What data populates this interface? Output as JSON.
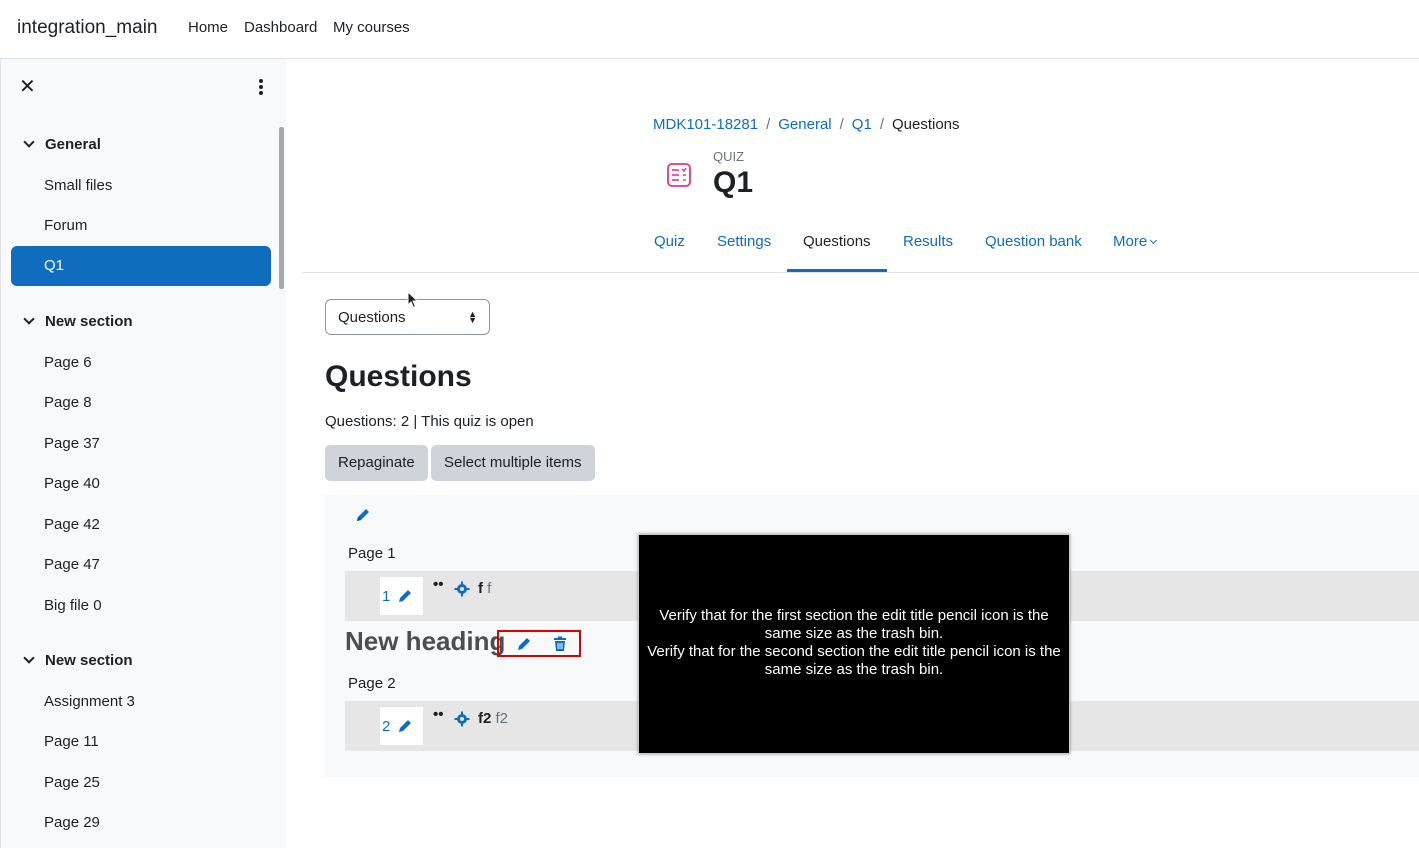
{
  "navbar": {
    "site_name": "integration_main",
    "links": [
      "Home",
      "Dashboard",
      "My courses"
    ]
  },
  "drawer": {
    "close_glyph": "✕",
    "sections": [
      {
        "title": "General",
        "items": [
          "Small files",
          "Forum",
          "Q1"
        ],
        "active": "Q1"
      },
      {
        "title": "New section",
        "items": [
          "Page 6",
          "Page 8",
          "Page 37",
          "Page 40",
          "Page 42",
          "Page 47",
          "Big file 0"
        ]
      },
      {
        "title": "New section",
        "items": [
          "Assignment 3",
          "Page 11",
          "Page 25",
          "Page 29"
        ]
      }
    ]
  },
  "breadcrumb": [
    "MDK101-18281",
    "General",
    "Q1",
    "Questions"
  ],
  "header": {
    "kicker": "QUIZ",
    "title": "Q1",
    "icon": "quiz-icon",
    "accent": "#e2348c"
  },
  "tabs": [
    {
      "label": "Quiz",
      "active": false
    },
    {
      "label": "Settings",
      "active": false
    },
    {
      "label": "Questions",
      "active": true
    },
    {
      "label": "Results",
      "active": false
    },
    {
      "label": "Question bank",
      "active": false
    },
    {
      "label": "More",
      "active": false
    }
  ],
  "select": {
    "value": "Questions"
  },
  "main": {
    "heading": "Questions",
    "status": "Questions: 2 | This quiz is open",
    "buttons": {
      "repaginate": "Repaginate",
      "select_multiple": "Select multiple items"
    }
  },
  "quiz_edit": {
    "pages": [
      {
        "label": "Page 1",
        "slot_number": "1",
        "question_name": "f",
        "question_text": "f"
      },
      {
        "label": "Page 2",
        "slot_number": "2",
        "question_name": "f2",
        "question_text": "f2"
      }
    ],
    "section_heading": "New heading",
    "dots": "••"
  },
  "overlay": {
    "line1": "Verify that for the first section the edit title pencil icon is the same size as the trash bin.",
    "line2": "Verify that for the second section the edit title pencil icon is the same size as the trash bin."
  },
  "colors": {
    "primary": "#0f6cbf",
    "highlight": "#e00000",
    "overlay_bg": "#000000"
  }
}
